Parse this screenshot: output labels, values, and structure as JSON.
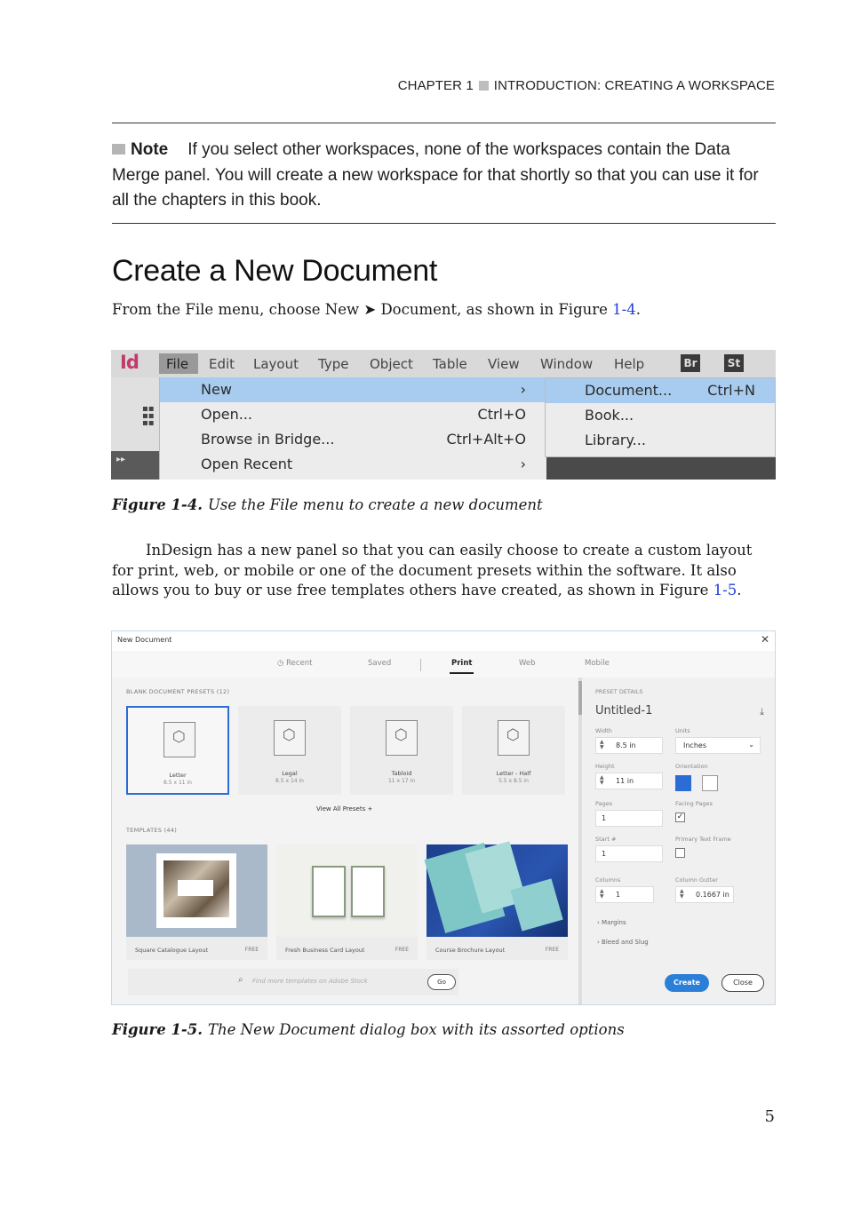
{
  "running_head": {
    "chapter": "CHAPTER 1",
    "title": "INTRODUCTION: CREATING A WORKSPACE"
  },
  "note": {
    "label": "Note",
    "text": "If you select other workspaces, none of the workspaces contain the Data Merge panel. You will create a new workspace for that shortly so that you can use it for all the chapters in this book."
  },
  "heading": "Create a New Document",
  "para1": {
    "before": "From the File menu, choose New ➤ Document, as shown in Figure ",
    "link": "1-4",
    "after": "."
  },
  "fig4": {
    "logo": "Id",
    "menus": [
      "File",
      "Edit",
      "Layout",
      "Type",
      "Object",
      "Table",
      "View",
      "Window",
      "Help"
    ],
    "badges": [
      "Br",
      "St"
    ],
    "items": [
      {
        "label": "New",
        "shortcut": "›"
      },
      {
        "label": "Open...",
        "shortcut": "Ctrl+O"
      },
      {
        "label": "Browse in Bridge...",
        "shortcut": "Ctrl+Alt+O"
      },
      {
        "label": "Open Recent",
        "shortcut": "›"
      }
    ],
    "submenu": [
      {
        "label": "Document...",
        "shortcut": "Ctrl+N"
      },
      {
        "label": "Book...",
        "shortcut": ""
      },
      {
        "label": "Library...",
        "shortcut": ""
      }
    ]
  },
  "caption4": {
    "label": "Figure 1-4.",
    "text": "Use the File menu to create a new document"
  },
  "para2": {
    "before": "InDesign has a new panel so that you can easily choose to create a custom layout for print, web, or mobile or one of the document presets within the software. It also allows you to buy or use free templates others have created, as shown in Figure ",
    "link": "1-5",
    "after": "."
  },
  "fig5": {
    "title": "New Document",
    "tabs": [
      "Recent",
      "Saved",
      "Print",
      "Web",
      "Mobile"
    ],
    "active_tab": "Print",
    "presets_label": "BLANK DOCUMENT PRESETS  (12)",
    "presets": [
      {
        "name": "Letter",
        "size": "8.5 x 11 in"
      },
      {
        "name": "Legal",
        "size": "8.5 x 14 in"
      },
      {
        "name": "Tabloid",
        "size": "11 x 17 in"
      },
      {
        "name": "Letter - Half",
        "size": "5.5 x 8.5 in"
      }
    ],
    "view_all": "View All Presets  +",
    "templates_label": "TEMPLATES  (44)",
    "templates": [
      {
        "name": "Square Catalogue Layout",
        "price": "FREE"
      },
      {
        "name": "Fresh Business Card Layout",
        "price": "FREE"
      },
      {
        "name": "Course Brochure Layout",
        "price": "FREE"
      }
    ],
    "search_placeholder": "Find more templates on Adobe Stock",
    "go": "Go",
    "details": {
      "section": "PRESET DETAILS",
      "doc_name": "Untitled-1",
      "width_label": "Width",
      "width": "8.5 in",
      "units_label": "Units",
      "units": "Inches",
      "height_label": "Height",
      "height": "11 in",
      "orientation_label": "Orientation",
      "pages_label": "Pages",
      "pages": "1",
      "facing_label": "Facing Pages",
      "start_label": "Start #",
      "start": "1",
      "primary_label": "Primary Text Frame",
      "columns_label": "Columns",
      "columns": "1",
      "gutter_label": "Column Gutter",
      "gutter": "0.1667 in",
      "margins": "Margins",
      "bleed": "Bleed and Slug"
    },
    "create": "Create",
    "close": "Close"
  },
  "caption5": {
    "label": "Figure 1-5.",
    "text": "The New Document dialog box with its assorted options"
  },
  "page_number": "5"
}
